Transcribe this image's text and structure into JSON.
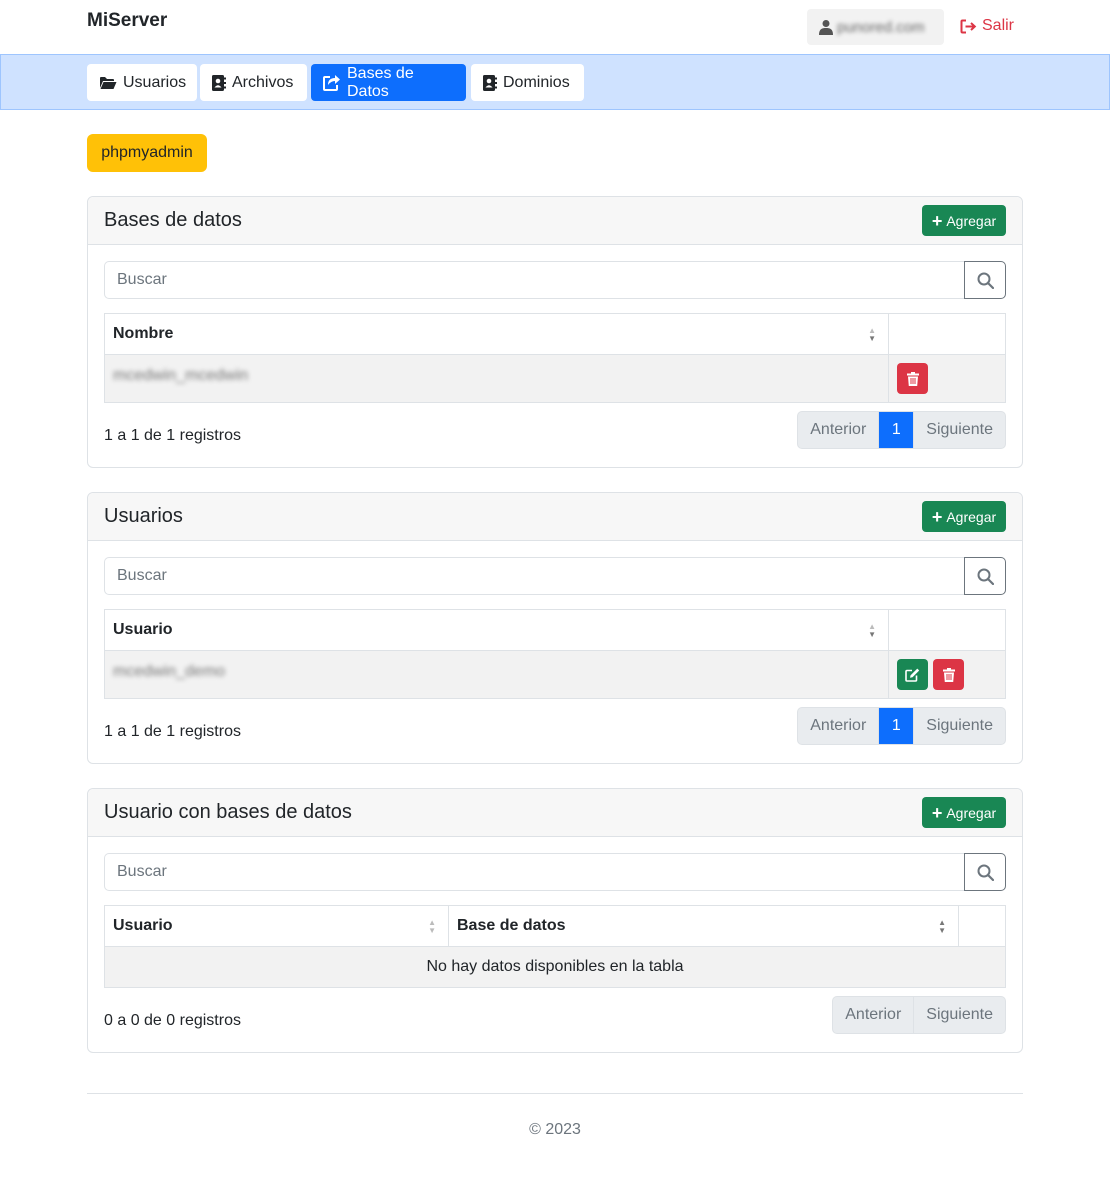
{
  "header": {
    "brand": "MiServer",
    "user": "punored.com",
    "logout_label": "Salir"
  },
  "nav": {
    "tabs": [
      {
        "label": "Usuarios",
        "active": false
      },
      {
        "label": "Archivos",
        "active": false
      },
      {
        "label": "Bases de Datos",
        "active": true
      },
      {
        "label": "Dominios",
        "active": false
      }
    ]
  },
  "phpmyadmin_label": "phpmyadmin",
  "databases": {
    "title": "Bases de datos",
    "add_label": "Agregar",
    "search_placeholder": "Buscar",
    "columns": [
      "Nombre",
      ""
    ],
    "rows": [
      {
        "name": "mcedwin_mcedwin"
      }
    ],
    "info": "1 a 1 de 1 registros",
    "pager": {
      "prev": "Anterior",
      "page": "1",
      "next": "Siguiente"
    }
  },
  "users": {
    "title": "Usuarios",
    "add_label": "Agregar",
    "search_placeholder": "Buscar",
    "columns": [
      "Usuario",
      ""
    ],
    "rows": [
      {
        "name": "mcedwin_demo"
      }
    ],
    "info": "1 a 1 de 1 registros",
    "pager": {
      "prev": "Anterior",
      "page": "1",
      "next": "Siguiente"
    }
  },
  "user_dbs": {
    "title": "Usuario con bases de datos",
    "add_label": "Agregar",
    "search_placeholder": "Buscar",
    "columns": [
      "Usuario",
      "Base de datos",
      ""
    ],
    "empty_message": "No hay datos disponibles en la tabla",
    "info": "0 a 0 de 0 registros",
    "pager": {
      "prev": "Anterior",
      "next": "Siguiente"
    }
  },
  "footer": {
    "copyright": "© 2023"
  },
  "colors": {
    "primary": "#0d6efd",
    "success": "#198754",
    "danger": "#dc3545",
    "warning": "#ffc107",
    "nav_bg": "#cfe2ff"
  }
}
